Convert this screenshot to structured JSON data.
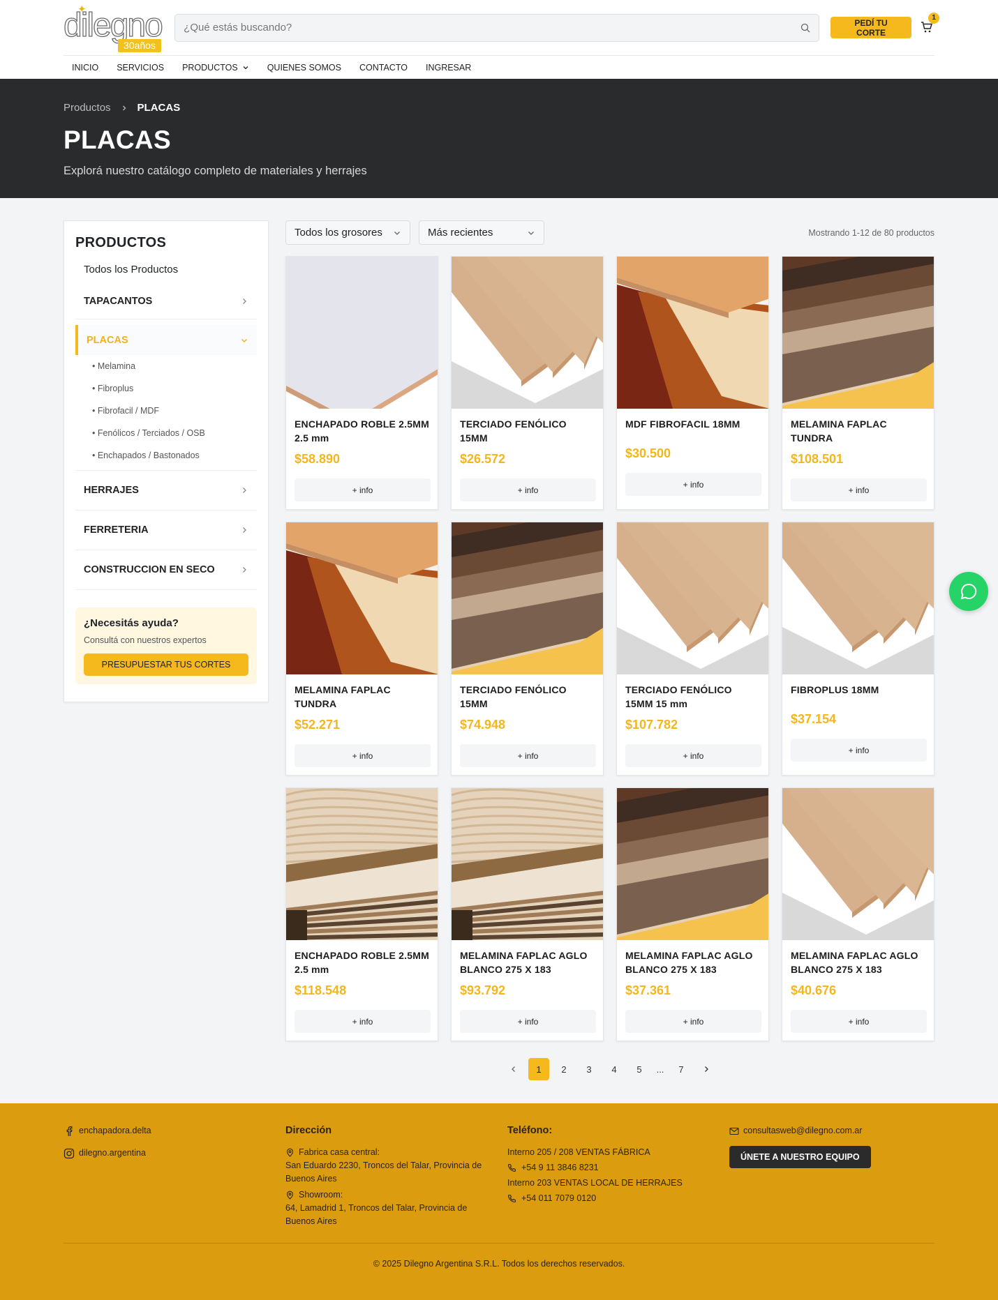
{
  "header": {
    "logo_text": "dilegno",
    "logo_years": "30años",
    "search_placeholder": "¿Qué estás buscando?",
    "cta": "PEDÍ TU CORTE",
    "cart_count": "1",
    "nav": [
      "INICIO",
      "SERVICIOS",
      "PRODUCTOS",
      "QUIENES SOMOS",
      "CONTACTO",
      "INGRESAR"
    ]
  },
  "hero": {
    "breadcrumb": [
      "Productos",
      "PLACAS"
    ],
    "title": "PLACAS",
    "subtitle": "Explorá nuestro catálogo completo de materiales y herrajes"
  },
  "sidebar": {
    "title": "PRODUCTOS",
    "all": "Todos los Productos",
    "cats": [
      "TAPACANTOS",
      "PLACAS",
      "HERRAJES",
      "FERRETERIA",
      "CONSTRUCCION EN SECO"
    ],
    "subs": [
      "• Melamina",
      "• Fibroplus",
      "• Fibrofacil / MDF",
      "• Fenólicos / Terciados / OSB",
      "• Enchapados / Bastonados"
    ],
    "help_title": "¿Necesitás ayuda?",
    "help_desc": "Consultá con nuestros expertos",
    "help_btn": "PRESUPUESTAR TUS CORTES"
  },
  "toolbar": {
    "filter": "Todos los grosores",
    "sort": "Más recientes",
    "count": "Mostrando 1-12 de 80 productos"
  },
  "products": [
    {
      "name": "ENCHAPADO ROBLE 2.5MM 2.5 mm",
      "price": "$58.890",
      "img": "white-boards"
    },
    {
      "name": "TERCIADO FENÓLICO 15MM",
      "price": "$26.572",
      "img": "kraft-boards"
    },
    {
      "name": "MDF FIBROFACIL 18MM",
      "price": "$30.500",
      "img": "wood-mix"
    },
    {
      "name": "MELAMINA FAPLAC TUNDRA",
      "price": "$108.501",
      "img": "dark-stripes"
    },
    {
      "name": "MELAMINA FAPLAC TUNDRA",
      "price": "$52.271",
      "img": "wood-mix"
    },
    {
      "name": "TERCIADO FENÓLICO 15MM",
      "price": "$74.948",
      "img": "dark-stripes"
    },
    {
      "name": "TERCIADO FENÓLICO 15MM 15 mm",
      "price": "$107.782",
      "img": "kraft-boards"
    },
    {
      "name": "FIBROPLUS 18MM",
      "price": "$37.154",
      "img": "kraft-boards"
    },
    {
      "name": "ENCHAPADO ROBLE 2.5MM 2.5 mm",
      "price": "$118.548",
      "img": "plywood"
    },
    {
      "name": "MELAMINA FAPLAC AGLO BLANCO 275 X 183",
      "price": "$93.792",
      "img": "plywood"
    },
    {
      "name": "MELAMINA FAPLAC AGLO BLANCO 275 X 183",
      "price": "$37.361",
      "img": "dark-stripes"
    },
    {
      "name": "MELAMINA FAPLAC AGLO BLANCO 275 X 183",
      "price": "$40.676",
      "img": "kraft-boards"
    }
  ],
  "info_label": "+ info",
  "pager": [
    "1",
    "2",
    "3",
    "4",
    "5",
    "...",
    "7"
  ],
  "footer": {
    "facebook": "enchapadora.delta",
    "instagram": "dilegno.argentina",
    "dir_title": "Dirección",
    "dir1_label": "Fabrica casa central:",
    "dir1": "San Eduardo 2230, Troncos del Talar, Provincia de Buenos Aires",
    "dir2_label": "Showroom:",
    "dir2": "64, Lamadrid 1, Troncos del Talar, Provincia de Buenos Aires",
    "tel_title": "Teléfono:",
    "tel1_label": "Interno 205 / 208 VENTAS FÁBRICA",
    "tel1": "+54 9 11 3846 8231",
    "tel2_label": "Interno 203 VENTAS LOCAL DE HERRAJES",
    "tel2": "+54 011 7079 0120",
    "email": "consultasweb@dilegno.com.ar",
    "join": "ÚNETE A NUESTRO EQUIPO",
    "copy": "© 2025 Dilegno Argentina S.R.L. Todos los derechos reservados."
  },
  "colors": {
    "accent": "#f6b91d",
    "hero": "#2a2b2d",
    "footer": "#dc9c0f",
    "whatsapp": "#25d366"
  }
}
